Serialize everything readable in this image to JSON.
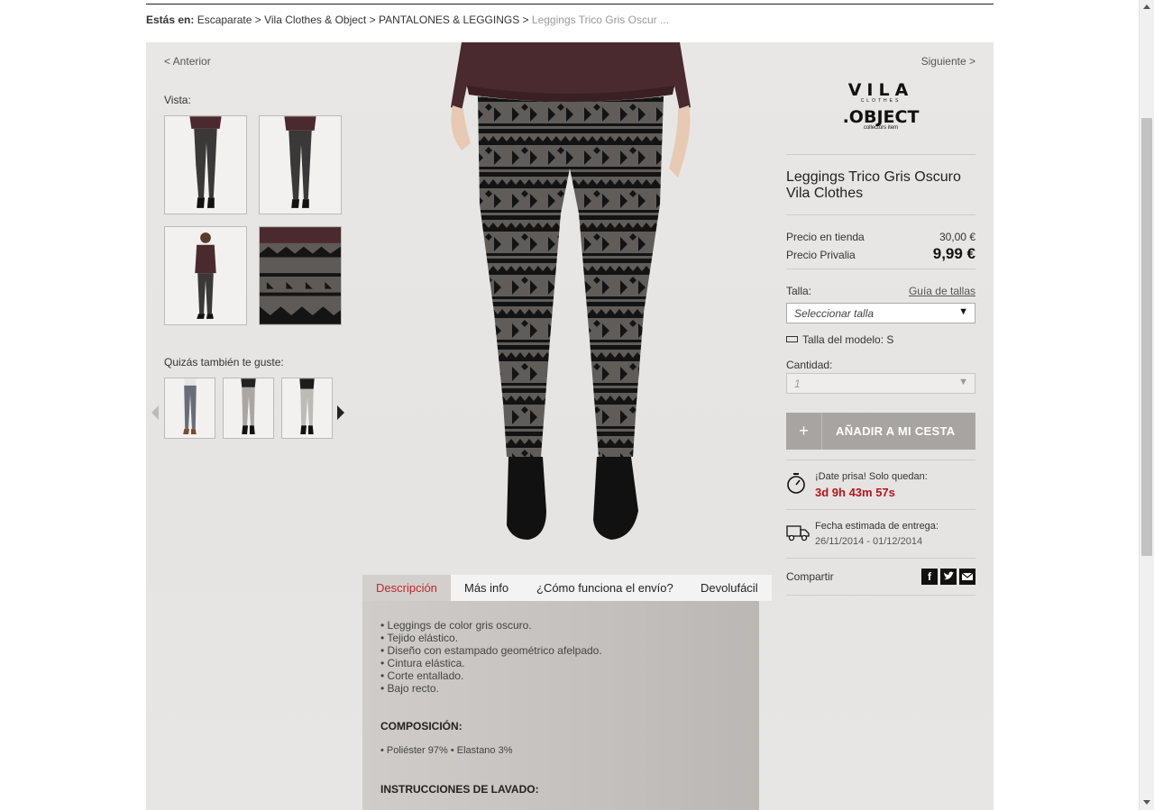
{
  "breadcrumb": {
    "prefix": "Estás en:",
    "items": [
      "Escaparate",
      "Vila Clothes & Object",
      "PANTALONES & LEGGINGS"
    ],
    "separator": " > ",
    "current": "Leggings Trico Gris Oscur ..."
  },
  "nav": {
    "prev": "< Anterior",
    "next": "Siguiente >"
  },
  "gallery": {
    "label": "Vista:",
    "thumb_icons": [
      "leggings-front-photo",
      "leggings-back-photo",
      "model-fullbody-photo",
      "pattern-detail-photo"
    ]
  },
  "related": {
    "label": "Quizás también te guste:",
    "items": [
      "grey-jeans-photo",
      "grey-jogger-photo",
      "light-grey-pants-photo"
    ]
  },
  "brand": {
    "line1": "VILA",
    "line1_sub": "CLOTHES",
    "line2": ".OBJECT",
    "line2_sub": "collectors item"
  },
  "product": {
    "title": "Leggings Trico Gris Oscuro Vila Clothes",
    "store_price_label": "Precio en tienda",
    "store_price": "30,00 €",
    "privalia_price_label": "Precio Privalia",
    "privalia_price": "9,99 €"
  },
  "size": {
    "label": "Talla:",
    "guide_link": "Guía de tallas",
    "select_placeholder": "Seleccionar talla",
    "model_size": "Talla del modelo: S"
  },
  "quantity": {
    "label": "Cantidad:",
    "value": "1"
  },
  "add_to_cart": {
    "plus": "+",
    "label": "AÑADIR A MI CESTA"
  },
  "hurry": {
    "text": "¡Date prisa! Solo quedan:",
    "countdown": "3d 9h 43m 57s"
  },
  "delivery": {
    "label": "Fecha estimada de entrega:",
    "dates": "26/11/2014 - 01/12/2014"
  },
  "share": {
    "label": "Compartir",
    "icons": [
      "facebook-icon",
      "twitter-icon",
      "email-icon"
    ]
  },
  "tabs": [
    "Descripción",
    "Más info",
    "¿Cómo funciona el envío?",
    "Devolufácil"
  ],
  "description": {
    "bullets": [
      "• Leggings de color gris oscuro.",
      "• Tejido elástico.",
      "• Diseño con estampado geométrico afelpado.",
      "• Cintura elástica.",
      "• Corte entallado.",
      "• Bajo recto."
    ],
    "composition_title": "COMPOSICIÓN:",
    "composition": "• Poliéster 97% • Elastano 3%",
    "washing_title": "INSTRUCCIONES DE LAVADO:"
  },
  "colors": {
    "accent_red": "#b3141c",
    "tab_active_red": "#c0272d",
    "button_grey": "#a8a4a1"
  }
}
